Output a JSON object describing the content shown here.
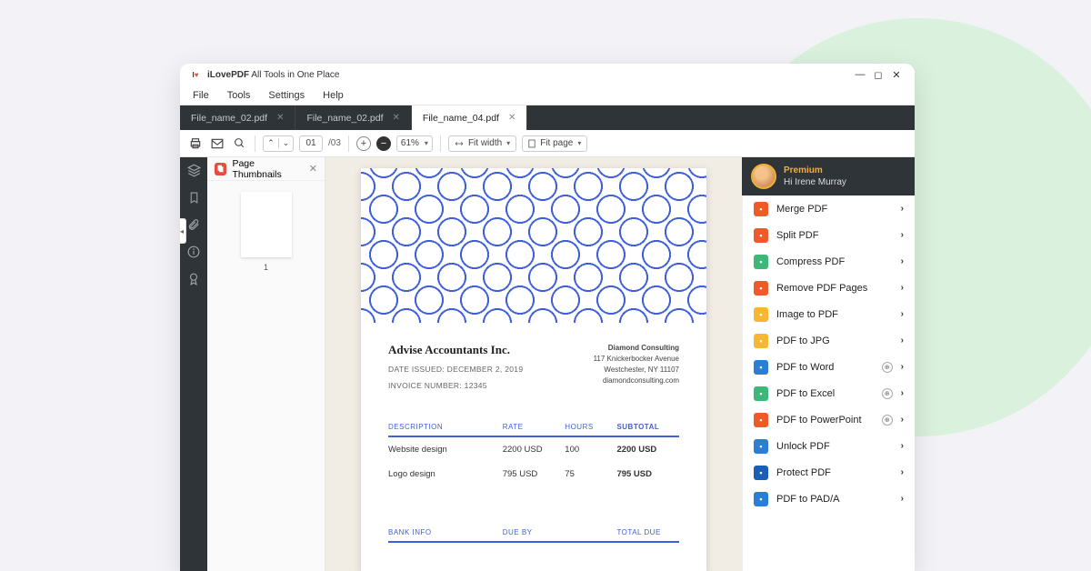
{
  "window": {
    "appTitle": "iLovePDF",
    "tagline": " All Tools in One Place"
  },
  "menu": [
    "File",
    "Tools",
    "Settings",
    "Help"
  ],
  "tabs": [
    {
      "label": "File_name_02.pdf",
      "active": false
    },
    {
      "label": "File_name_02.pdf",
      "active": false
    },
    {
      "label": "File_name_04.pdf",
      "active": true
    }
  ],
  "toolbar": {
    "page": "01",
    "total": "/03",
    "zoom": "61%",
    "fitwidth": "Fit width",
    "fitpage": "Fit page"
  },
  "thumbPanel": {
    "title": "Page Thumbnails",
    "pageNum": "1"
  },
  "document": {
    "company": "Advise Accountants Inc.",
    "dateIssued": "DATE ISSUED: DECEMBER 2, 2019",
    "invoiceNum": "INVOICE NUMBER: 12345",
    "client": {
      "name": "Diamond Consulting",
      "addr1": "117 Knickerbocker Avenue",
      "addr2": "Westchester, NY 11107",
      "web": "diamondconsulting.com"
    },
    "headers": {
      "desc": "DESCRIPTION",
      "rate": "RATE",
      "hours": "HOURS",
      "subtotal": "SUBTOTAL"
    },
    "rows": [
      {
        "desc": "Website design",
        "rate": "2200 USD",
        "hours": "100",
        "subtotal": "2200 USD"
      },
      {
        "desc": "Logo design",
        "rate": "795 USD",
        "hours": "75",
        "subtotal": "795 USD"
      }
    ],
    "footer": {
      "bank": "BANK INFO",
      "due": "DUE BY",
      "total": "TOTAL DUE"
    }
  },
  "user": {
    "tier": "Premium",
    "greeting": "Hi Irene Murray"
  },
  "tools": [
    {
      "label": "Merge PDF",
      "color": "#f05a28",
      "badge": false
    },
    {
      "label": "Split PDF",
      "color": "#f05a28",
      "badge": false
    },
    {
      "label": "Compress PDF",
      "color": "#3cb878",
      "badge": false
    },
    {
      "label": "Remove PDF Pages",
      "color": "#f05a28",
      "badge": false
    },
    {
      "label": "Image to PDF",
      "color": "#f7b733",
      "badge": false
    },
    {
      "label": "PDF to JPG",
      "color": "#f7b733",
      "badge": false
    },
    {
      "label": "PDF to Word",
      "color": "#2a7fd4",
      "badge": true
    },
    {
      "label": "PDF to Excel",
      "color": "#3cb878",
      "badge": true
    },
    {
      "label": "PDF to PowerPoint",
      "color": "#f05a28",
      "badge": true
    },
    {
      "label": "Unlock PDF",
      "color": "#2a7fd4",
      "badge": false
    },
    {
      "label": "Protect PDF",
      "color": "#1a5fb4",
      "badge": false
    },
    {
      "label": "PDF to PAD/A",
      "color": "#2a7fd4",
      "badge": false
    }
  ]
}
